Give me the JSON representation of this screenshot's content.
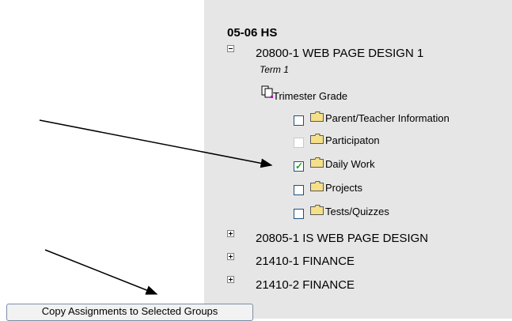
{
  "tree": {
    "year": "05-06 HS",
    "course_expanded": "20800-1 WEB PAGE DESIGN 1",
    "term": "Term 1",
    "grade_node": "Trimester Grade",
    "groups": [
      {
        "label": "Parent/Teacher Information",
        "checked": false,
        "disabled": false
      },
      {
        "label": "Participaton",
        "checked": false,
        "disabled": true
      },
      {
        "label": "Daily Work",
        "checked": true,
        "disabled": false
      },
      {
        "label": "Projects",
        "checked": false,
        "disabled": false
      },
      {
        "label": "Tests/Quizzes",
        "checked": false,
        "disabled": false
      }
    ],
    "collapsed_courses": [
      "20805-1 IS WEB PAGE DESIGN",
      "21410-1 FINANCE",
      "21410-2 FINANCE"
    ]
  },
  "actions": {
    "copy_button": "Copy Assignments to Selected Groups"
  },
  "colors": {
    "panel": "#e6e6e6",
    "checkbox_border": "#1c5180",
    "check_mark": "#21a121",
    "folder": "#f5e08a"
  }
}
